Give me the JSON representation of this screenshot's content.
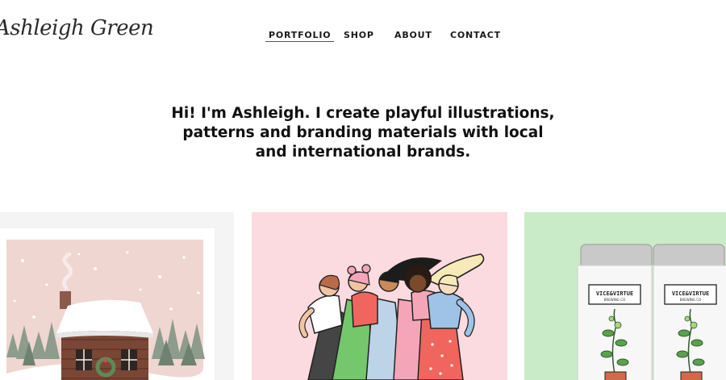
{
  "header": {
    "logo_text": "Ashleigh Green",
    "nav": [
      {
        "label": "PORTFOLIO",
        "active": true
      },
      {
        "label": "SHOP",
        "active": false
      },
      {
        "label": "ABOUT",
        "active": false
      },
      {
        "label": "CONTACT",
        "active": false
      }
    ]
  },
  "hero": {
    "lines": [
      "Hi! I'm Ashleigh. I create playful illustrations,",
      "patterns and branding materials with local",
      "and international brands."
    ]
  },
  "portfolio": {
    "cards": [
      {
        "subject": "snowy-cabin-print"
      },
      {
        "subject": "five-women-illustration"
      },
      {
        "subject": "vice-virtue-cans",
        "can_label_line1": "VICE&VIRTUE",
        "can_label_line2": "BREWING CO"
      }
    ]
  },
  "colors": {
    "card_1_bg": "#f4f4f4",
    "card_2_bg": "#fbdbe0",
    "card_3_bg": "#c9ebc7",
    "text": "#111111"
  }
}
